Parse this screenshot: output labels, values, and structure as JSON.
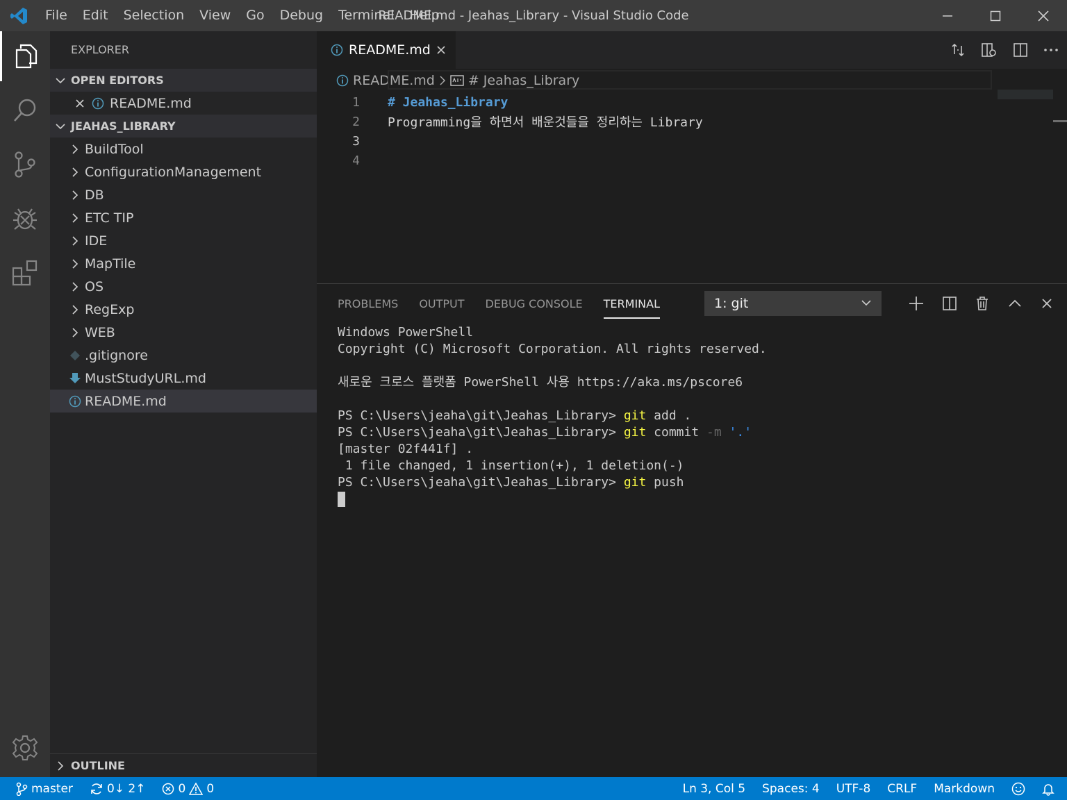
{
  "window": {
    "title": "README.md - Jeahas_Library - Visual Studio Code"
  },
  "menu": [
    "File",
    "Edit",
    "Selection",
    "View",
    "Go",
    "Debug",
    "Terminal",
    "Help"
  ],
  "sidebar": {
    "title": "EXPLORER",
    "open_editors_label": "OPEN EDITORS",
    "open_editor_file": "README.md",
    "folder_label": "JEAHAS_LIBRARY",
    "folders": [
      "BuildTool",
      "ConfigurationManagement",
      "DB",
      "ETC TIP",
      "IDE",
      "MapTile",
      "OS",
      "RegExp",
      "WEB"
    ],
    "files": [
      ".gitignore",
      "MustStudyURL.md",
      "README.md"
    ],
    "outline_label": "OUTLINE"
  },
  "editor": {
    "tab_label": "README.md",
    "breadcrumb_file": "README.md",
    "breadcrumb_symbol": "# Jeahas_Library",
    "lines": [
      {
        "num": "1",
        "text": "# Jeahas_Library"
      },
      {
        "num": "2",
        "text": "Programming을 하면서 배운것들을 정리하는 Library"
      },
      {
        "num": "3",
        "text": ""
      },
      {
        "num": "4",
        "text": ""
      }
    ]
  },
  "panel": {
    "tabs": [
      "PROBLEMS",
      "OUTPUT",
      "DEBUG CONSOLE",
      "TERMINAL"
    ],
    "terminal_select": "1: git",
    "terminal": {
      "line1": "Windows PowerShell",
      "line2": "Copyright (C) Microsoft Corporation. All rights reserved.",
      "line3": "새로운 크로스 플랫폼 PowerShell 사용 https://aka.ms/pscore6",
      "prompt": "PS C:\\Users\\jeaha\\git\\Jeahas_Library> ",
      "git": "git",
      "cmd1_rest": " add .",
      "cmd2_rest": " commit ",
      "cmd2_flag": "-m",
      "cmd2_arg": " '.'",
      "out1": "[master 02f441f] .",
      "out2": " 1 file changed, 1 insertion(+), 1 deletion(-)",
      "cmd3_rest": " push"
    }
  },
  "statusbar": {
    "branch": "master",
    "sync": "0↓ 2↑",
    "errors": "0",
    "warnings": "0",
    "position": "Ln 3, Col 5",
    "spaces": "Spaces: 4",
    "encoding": "UTF-8",
    "eol": "CRLF",
    "language": "Markdown"
  },
  "colors": {
    "accent": "#007acc",
    "heading": "#569cd6",
    "terminal_command": "#f5f543"
  }
}
